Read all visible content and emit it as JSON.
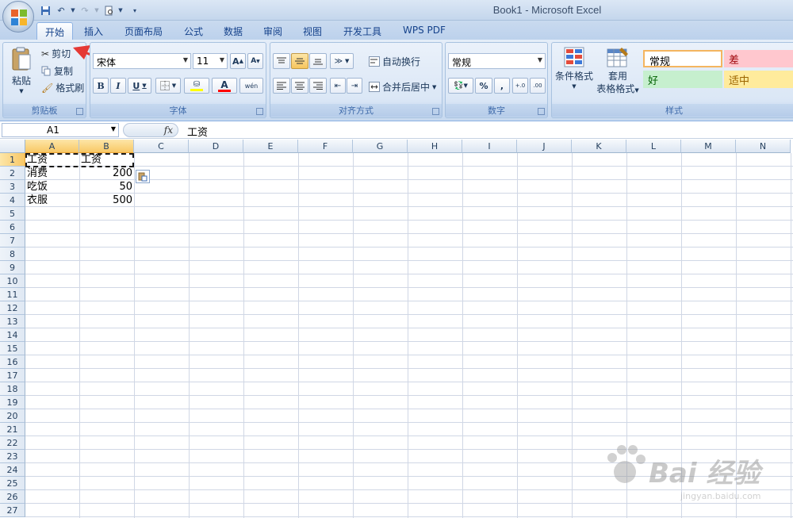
{
  "window": {
    "title": "Book1 - Microsoft Excel"
  },
  "tabs": [
    "开始",
    "插入",
    "页面布局",
    "公式",
    "数据",
    "审阅",
    "视图",
    "开发工具",
    "WPS PDF"
  ],
  "clipboard": {
    "paste": "粘贴",
    "cut": "剪切",
    "copy": "复制",
    "format_painter": "格式刷",
    "label": "剪贴板"
  },
  "font": {
    "name": "宋体",
    "size": "11",
    "label": "字体",
    "bold": "B",
    "italic": "I",
    "underline": "U",
    "grow": "A",
    "shrink": "A",
    "phonetic": "wén",
    "font_color_glyph": "A"
  },
  "alignment": {
    "wrap": "自动换行",
    "merge": "合并后居中",
    "label": "对齐方式"
  },
  "number": {
    "format": "常规",
    "percent": "%",
    "comma": ",",
    "inc_decimal": "+.0",
    "dec_decimal": ".00",
    "label": "数字"
  },
  "styles": {
    "conditional": "条件格式",
    "table1": "套用",
    "table2": "表格格式",
    "normal": "常规",
    "bad": "差",
    "good": "好",
    "neutral": "适中",
    "label": "样式"
  },
  "formula_bar": {
    "name_box": "A1",
    "fx": "fx",
    "content": "工资"
  },
  "columns": [
    "A",
    "B",
    "C",
    "D",
    "E",
    "F",
    "G",
    "H",
    "I",
    "J",
    "K",
    "L",
    "M",
    "N"
  ],
  "rows": [
    "1",
    "2",
    "3",
    "4",
    "5",
    "6",
    "7",
    "8",
    "9",
    "10",
    "11",
    "12",
    "13",
    "14",
    "15",
    "16",
    "17",
    "18",
    "19",
    "20",
    "21",
    "22",
    "23",
    "24",
    "25",
    "26",
    "27"
  ],
  "cells": {
    "A1": "工资",
    "B1": "工资",
    "A2": "消费",
    "B2": "200",
    "A3": "吃饭",
    "B3": "50",
    "A4": "衣服",
    "B4": "500"
  },
  "watermark": {
    "brand": "Bai 经验",
    "url": "jingyan.baidu.com"
  },
  "colors": {
    "annotation_arrow": "#e53935",
    "selection_header": "#f8c765",
    "bad_bg": "#ffc7ce",
    "good_bg": "#c6efce",
    "neutral_bg": "#ffeb9c"
  }
}
